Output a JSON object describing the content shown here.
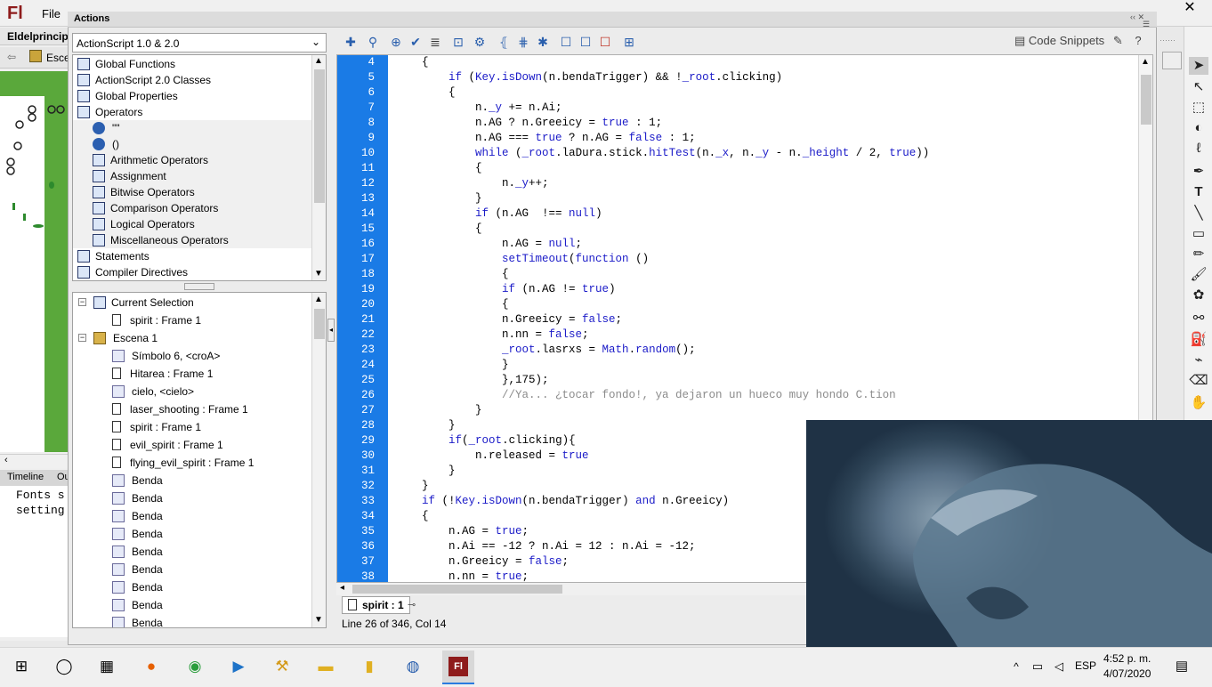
{
  "app": {
    "logo": "Fl",
    "menu_file": "File",
    "close_glyph": "✕"
  },
  "left_panel": {
    "doc_tab": "Eldelprincipi",
    "scene_label": "Esce",
    "timeline_tab": "Timeline",
    "output_tab": "Ou",
    "output_text": "Fonts s\nsetting"
  },
  "dialog": {
    "title": "Actions",
    "language_select": "ActionScript 1.0 & 2.0",
    "code_snippets": "Code Snippets"
  },
  "toolbox": {
    "items": [
      {
        "label": "Global Functions",
        "indent": 0,
        "icon": "book-icon"
      },
      {
        "label": "ActionScript 2.0 Classes",
        "indent": 0,
        "icon": "book-icon"
      },
      {
        "label": "Global Properties",
        "indent": 0,
        "icon": "book-icon"
      },
      {
        "label": "Operators",
        "indent": 0,
        "icon": "open-book-icon"
      },
      {
        "label": "\"\"",
        "indent": 1,
        "icon": "operator-circle-icon"
      },
      {
        "label": "()",
        "indent": 1,
        "icon": "operator-circle-icon"
      },
      {
        "label": "Arithmetic Operators",
        "indent": 1,
        "icon": "book-icon"
      },
      {
        "label": "Assignment",
        "indent": 1,
        "icon": "book-icon"
      },
      {
        "label": "Bitwise Operators",
        "indent": 1,
        "icon": "book-icon"
      },
      {
        "label": "Comparison Operators",
        "indent": 1,
        "icon": "book-icon"
      },
      {
        "label": "Logical Operators",
        "indent": 1,
        "icon": "book-icon"
      },
      {
        "label": "Miscellaneous Operators",
        "indent": 1,
        "icon": "book-icon"
      },
      {
        "label": "Statements",
        "indent": 0,
        "icon": "book-icon"
      },
      {
        "label": "Compiler Directives",
        "indent": 0,
        "icon": "book-icon"
      }
    ]
  },
  "script_nav": {
    "items": [
      {
        "label": "Current Selection",
        "level": 0,
        "expand": "−",
        "icon": "selection-icon"
      },
      {
        "label": "spirit : Frame 1",
        "level": 1,
        "icon": "frame-icon"
      },
      {
        "label": "Escena 1",
        "level": 0,
        "expand": "−",
        "icon": "scene-icon"
      },
      {
        "label": "Símbolo 6, <croA>",
        "level": 1,
        "icon": "symbol-icon"
      },
      {
        "label": "Hitarea : Frame 1",
        "level": 1,
        "icon": "frame-icon"
      },
      {
        "label": "cielo, <cielo>",
        "level": 1,
        "icon": "symbol-icon"
      },
      {
        "label": "laser_shooting : Frame 1",
        "level": 1,
        "icon": "frame-icon"
      },
      {
        "label": "spirit : Frame 1",
        "level": 1,
        "icon": "frame-icon"
      },
      {
        "label": "evil_spirit : Frame 1",
        "level": 1,
        "icon": "frame-icon"
      },
      {
        "label": "flying_evil_spirit : Frame 1",
        "level": 1,
        "icon": "frame-icon"
      },
      {
        "label": "Benda",
        "level": 1,
        "icon": "symbol-icon"
      },
      {
        "label": "Benda",
        "level": 1,
        "icon": "symbol-icon"
      },
      {
        "label": "Benda",
        "level": 1,
        "icon": "symbol-icon"
      },
      {
        "label": "Benda",
        "level": 1,
        "icon": "symbol-icon"
      },
      {
        "label": "Benda",
        "level": 1,
        "icon": "symbol-icon"
      },
      {
        "label": "Benda",
        "level": 1,
        "icon": "symbol-icon"
      },
      {
        "label": "Benda",
        "level": 1,
        "icon": "symbol-icon"
      },
      {
        "label": "Benda",
        "level": 1,
        "icon": "symbol-icon"
      },
      {
        "label": "Benda",
        "level": 1,
        "icon": "symbol-icon"
      }
    ]
  },
  "editor": {
    "lines": [
      {
        "n": "4",
        "segs": [
          {
            "t": "{"
          }
        ]
      },
      {
        "n": "5",
        "segs": [
          {
            "t": "    "
          },
          {
            "t": "if",
            "k": "kw"
          },
          {
            "t": " ("
          },
          {
            "t": "Key.isDown",
            "k": "kw"
          },
          {
            "t": "(n.bendaTrigger) && !"
          },
          {
            "t": "_root",
            "k": "kw"
          },
          {
            "t": ".clicking)"
          }
        ]
      },
      {
        "n": "6",
        "segs": [
          {
            "t": "    {"
          }
        ]
      },
      {
        "n": "7",
        "segs": [
          {
            "t": "        n."
          },
          {
            "t": "_y",
            "k": "kw"
          },
          {
            "t": " += n.Ai;"
          }
        ]
      },
      {
        "n": "8",
        "segs": [
          {
            "t": "        n.AG ? n.Greeicy = "
          },
          {
            "t": "true",
            "k": "kw"
          },
          {
            "t": " : 1;"
          }
        ]
      },
      {
        "n": "9",
        "segs": [
          {
            "t": "        n.AG === "
          },
          {
            "t": "true",
            "k": "kw"
          },
          {
            "t": " ? n.AG = "
          },
          {
            "t": "false",
            "k": "kw"
          },
          {
            "t": " : 1;"
          }
        ]
      },
      {
        "n": "10",
        "segs": [
          {
            "t": "        "
          },
          {
            "t": "while",
            "k": "kw"
          },
          {
            "t": " ("
          },
          {
            "t": "_root",
            "k": "kw"
          },
          {
            "t": ".laDura.stick."
          },
          {
            "t": "hitTest",
            "k": "kw"
          },
          {
            "t": "(n."
          },
          {
            "t": "_x",
            "k": "kw"
          },
          {
            "t": ", n."
          },
          {
            "t": "_y",
            "k": "kw"
          },
          {
            "t": " - n."
          },
          {
            "t": "_height",
            "k": "kw"
          },
          {
            "t": " / 2, "
          },
          {
            "t": "true",
            "k": "kw"
          },
          {
            "t": "))"
          }
        ]
      },
      {
        "n": "11",
        "segs": [
          {
            "t": "        {"
          }
        ]
      },
      {
        "n": "12",
        "segs": [
          {
            "t": "            n."
          },
          {
            "t": "_y",
            "k": "kw"
          },
          {
            "t": "++;"
          }
        ]
      },
      {
        "n": "13",
        "segs": [
          {
            "t": "        }"
          }
        ]
      },
      {
        "n": "14",
        "segs": [
          {
            "t": "        "
          },
          {
            "t": "if",
            "k": "kw"
          },
          {
            "t": " (n.AG  !== "
          },
          {
            "t": "null",
            "k": "kw"
          },
          {
            "t": ")"
          }
        ]
      },
      {
        "n": "15",
        "segs": [
          {
            "t": "        {"
          }
        ]
      },
      {
        "n": "16",
        "segs": [
          {
            "t": "            n.AG = "
          },
          {
            "t": "null",
            "k": "kw"
          },
          {
            "t": ";"
          }
        ]
      },
      {
        "n": "17",
        "segs": [
          {
            "t": "            "
          },
          {
            "t": "setTimeout",
            "k": "kw"
          },
          {
            "t": "("
          },
          {
            "t": "function",
            "k": "kw"
          },
          {
            "t": " ()"
          }
        ]
      },
      {
        "n": "18",
        "segs": [
          {
            "t": "            {"
          }
        ]
      },
      {
        "n": "19",
        "segs": [
          {
            "t": "            "
          },
          {
            "t": "if",
            "k": "kw"
          },
          {
            "t": " (n.AG != "
          },
          {
            "t": "true",
            "k": "kw"
          },
          {
            "t": ")"
          }
        ]
      },
      {
        "n": "20",
        "segs": [
          {
            "t": "            {"
          }
        ]
      },
      {
        "n": "21",
        "segs": [
          {
            "t": "            n.Greeicy = "
          },
          {
            "t": "false",
            "k": "kw"
          },
          {
            "t": ";"
          }
        ]
      },
      {
        "n": "22",
        "segs": [
          {
            "t": "            n.nn = "
          },
          {
            "t": "false",
            "k": "kw"
          },
          {
            "t": ";"
          }
        ]
      },
      {
        "n": "23",
        "segs": [
          {
            "t": "            "
          },
          {
            "t": "_root",
            "k": "kw"
          },
          {
            "t": ".lasrxs = "
          },
          {
            "t": "Math",
            "k": "kw"
          },
          {
            "t": "."
          },
          {
            "t": "random",
            "k": "kw"
          },
          {
            "t": "();"
          }
        ]
      },
      {
        "n": "24",
        "segs": [
          {
            "t": "            }"
          }
        ]
      },
      {
        "n": "25",
        "segs": [
          {
            "t": "            },175);"
          }
        ]
      },
      {
        "n": "26",
        "segs": [
          {
            "t": "            "
          },
          {
            "t": "//Ya... ¿tocar fondo!, ya dejaron un hueco muy hondo C.tion",
            "k": "cm"
          }
        ]
      },
      {
        "n": "27",
        "segs": [
          {
            "t": "        }"
          }
        ]
      },
      {
        "n": "28",
        "segs": [
          {
            "t": "    }"
          }
        ]
      },
      {
        "n": "29",
        "segs": [
          {
            "t": "    "
          },
          {
            "t": "if",
            "k": "kw"
          },
          {
            "t": "("
          },
          {
            "t": "_root",
            "k": "kw"
          },
          {
            "t": ".clicking){"
          }
        ]
      },
      {
        "n": "30",
        "segs": [
          {
            "t": "        n.released = "
          },
          {
            "t": "true",
            "k": "kw"
          }
        ]
      },
      {
        "n": "31",
        "segs": [
          {
            "t": "    }"
          }
        ]
      },
      {
        "n": "32",
        "segs": [
          {
            "t": "}"
          }
        ]
      },
      {
        "n": "33",
        "segs": [
          {
            "t": "if",
            "k": "kw"
          },
          {
            "t": " (!"
          },
          {
            "t": "Key.isDown",
            "k": "kw"
          },
          {
            "t": "(n.bendaTrigger) "
          },
          {
            "t": "and",
            "k": "kw"
          },
          {
            "t": " n.Greeicy)"
          }
        ]
      },
      {
        "n": "34",
        "segs": [
          {
            "t": "{"
          }
        ]
      },
      {
        "n": "35",
        "segs": [
          {
            "t": "    n.AG = "
          },
          {
            "t": "true",
            "k": "kw"
          },
          {
            "t": ";"
          }
        ]
      },
      {
        "n": "36",
        "segs": [
          {
            "t": "    n.Ai == -12 ? n.Ai = 12 : n.Ai = -12;"
          }
        ]
      },
      {
        "n": "37",
        "segs": [
          {
            "t": "    n.Greeicy = "
          },
          {
            "t": "false",
            "k": "kw"
          },
          {
            "t": ";"
          }
        ]
      },
      {
        "n": "38",
        "segs": [
          {
            "t": "    n.nn = "
          },
          {
            "t": "true",
            "k": "kw"
          },
          {
            "t": ";"
          }
        ]
      }
    ],
    "file_tab": "spirit : 1",
    "status": "Line 26 of 346, Col 14"
  },
  "taskbar": {
    "apps": [
      "start-icon",
      "search-circle-icon",
      "task-view-icon",
      "firefox-icon",
      "chrome-icon",
      "video-editor-icon",
      "tool-icon",
      "file-explorer-icon",
      "document-icon",
      "browser-icon",
      "flash-icon"
    ],
    "lang": "ESP",
    "time": "4:52 p. m.",
    "date": "4/07/2020"
  },
  "colors": {
    "gutter": "#1a7be6",
    "keyword": "#1b1bc8",
    "comment": "#8b8b8b",
    "stage_green": "#5aa83b",
    "flash_red": "#8e1b1b"
  }
}
